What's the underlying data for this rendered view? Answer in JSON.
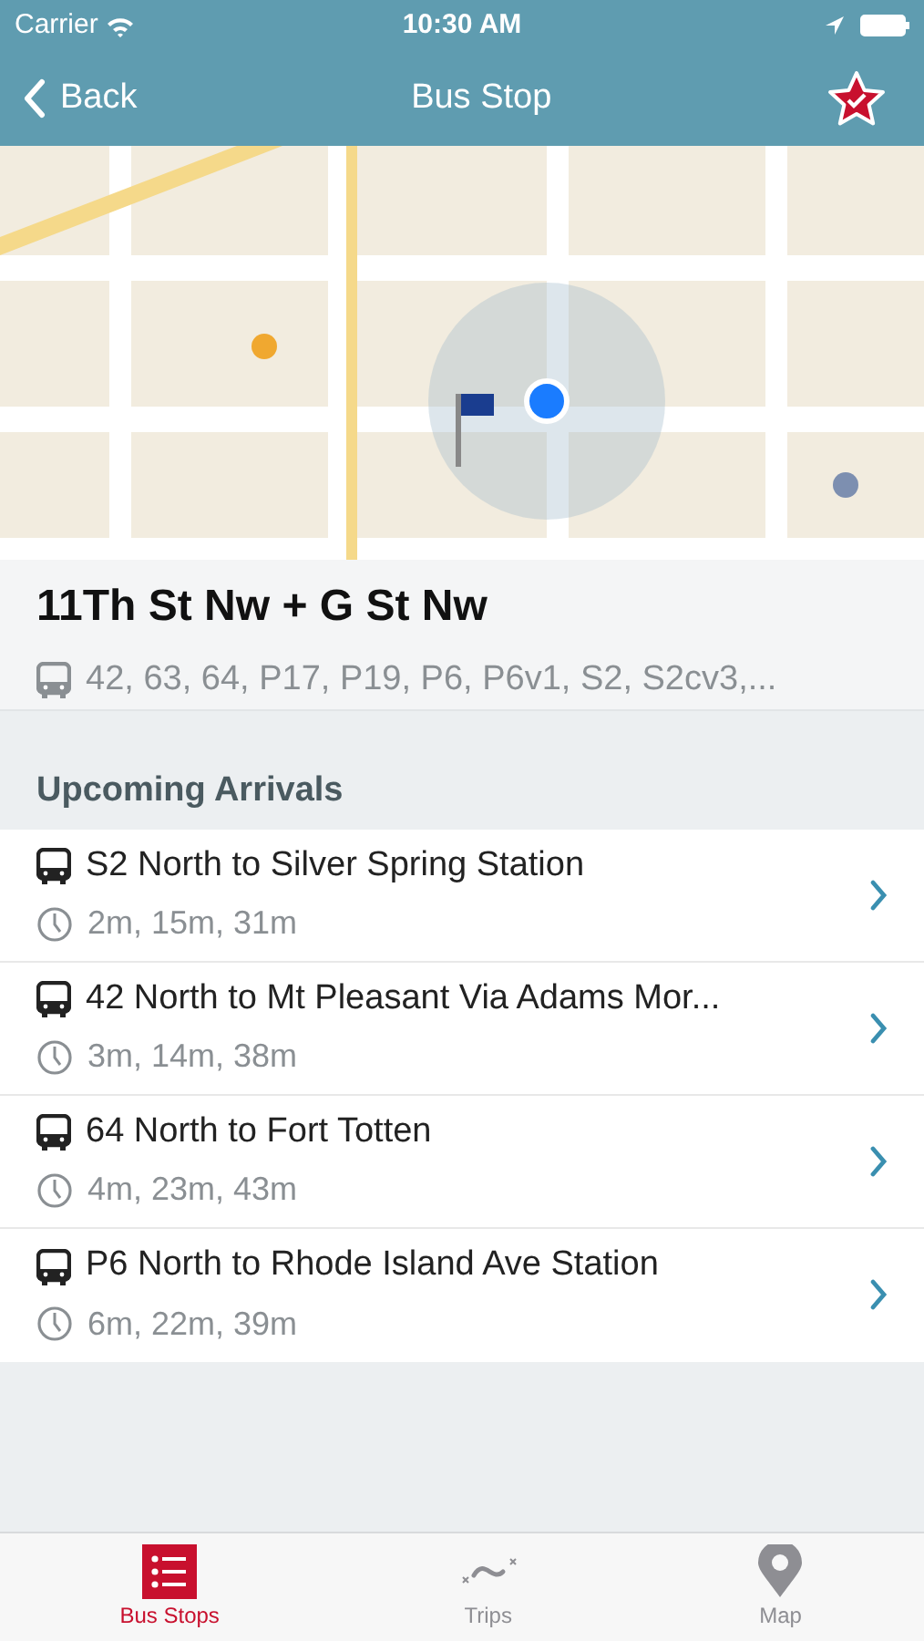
{
  "status_bar": {
    "carrier": "Carrier",
    "time": "10:30 AM"
  },
  "nav": {
    "back": "Back",
    "title": "Bus Stop",
    "favorite": true
  },
  "stop": {
    "name": "11Th St Nw + G St Nw",
    "routes": "42, 63, 64, P17, P19, P6, P6v1, S2, S2cv3,..."
  },
  "arrivals": {
    "heading": "Upcoming Arrivals",
    "items": [
      {
        "route": "S2 North to Silver Spring Station",
        "times": "2m, 15m, 31m"
      },
      {
        "route": "42 North to Mt Pleasant Via Adams Mor...",
        "times": "3m, 14m, 38m"
      },
      {
        "route": "64 North to Fort Totten",
        "times": "4m, 23m, 43m"
      },
      {
        "route": "P6 North to Rhode Island Ave Station",
        "times": "6m, 22m, 39m"
      }
    ]
  },
  "tab_bar": [
    {
      "label": "Bus Stops",
      "kind": "stops",
      "selected": true
    },
    {
      "label": "Trips",
      "kind": "trips",
      "selected": false
    },
    {
      "label": "Map",
      "kind": "map",
      "selected": false
    }
  ]
}
